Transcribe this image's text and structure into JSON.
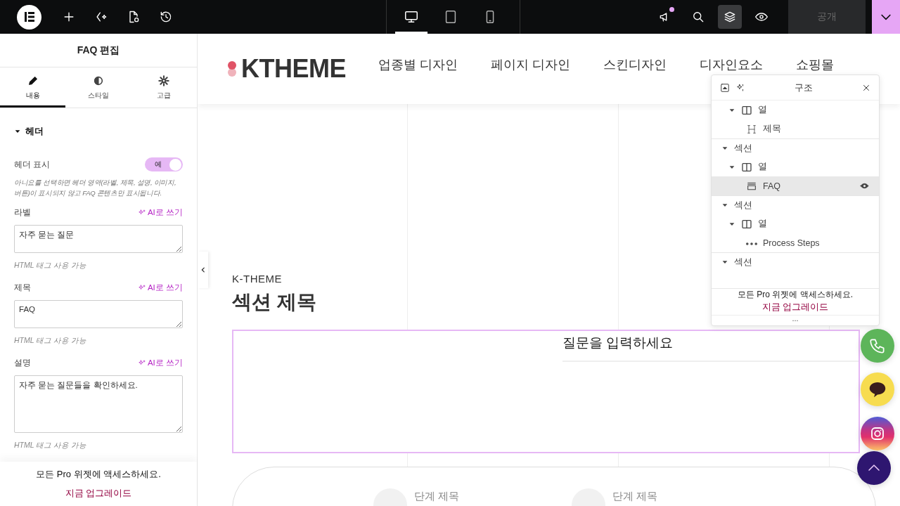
{
  "topbar": {
    "devices": [
      {
        "kind": "desktop",
        "selected": true
      },
      {
        "kind": "tablet",
        "selected": false
      },
      {
        "kind": "mobile",
        "selected": false
      }
    ],
    "notification": true,
    "layers_active": true,
    "publish": {
      "label": "공개",
      "disabled": true
    }
  },
  "editor": {
    "title": "FAQ 편집",
    "tabs": [
      {
        "label": "내용",
        "kind": "content",
        "selected": true
      },
      {
        "label": "스타일",
        "kind": "style",
        "selected": false
      },
      {
        "label": "고급",
        "kind": "advanced",
        "selected": false
      }
    ],
    "section": {
      "title": "헤더",
      "expanded": true
    },
    "toggle": {
      "label": "헤더 표시",
      "on": true,
      "text": "예",
      "help": "아니요를 선택하면 헤더 영역(라벨, 제목, 설명, 이미지, 버튼)이 표시되지 않고 FAQ 콘텐츠만 표시됩니다."
    },
    "fields": [
      {
        "label": "라벨",
        "ai": "AI로 쓰기",
        "value": "자주 묻는 질문",
        "hint": "HTML 태그 사용 가능",
        "kind": "short"
      },
      {
        "label": "제목",
        "ai": "AI로 쓰기",
        "value": "FAQ",
        "hint": "HTML 태그 사용 가능",
        "kind": "short"
      },
      {
        "label": "설명",
        "ai": "AI로 쓰기",
        "value": "자주 묻는 질문들을 확인하세요.",
        "hint": "HTML 태그 사용 가능",
        "kind": "long"
      }
    ],
    "promo": {
      "text": "모든 Pro 위젯에 액세스하세요.",
      "link": "지금 업그레이드"
    }
  },
  "site": {
    "logo": "KTHEME",
    "nav": [
      "업종별 디자인",
      "페이지 디자인",
      "스킨디자인",
      "디자인요소",
      "쇼핑몰"
    ],
    "label": "K-THEME",
    "title": "섹션 제목",
    "faq": {
      "question": "질문을 입력하세요"
    },
    "steps": [
      {
        "title": "단계 제목"
      },
      {
        "title": "단계 제목"
      }
    ]
  },
  "structure": {
    "title": "구조",
    "tree": [
      {
        "label": "열",
        "kind": "column",
        "expanded": true,
        "selected": false,
        "children": [
          {
            "label": "제목",
            "kind": "heading",
            "selected": false
          }
        ]
      },
      {
        "label": "섹션",
        "kind": "section",
        "expanded": true,
        "selected": false,
        "children": [
          {
            "label": "열",
            "kind": "column",
            "expanded": true,
            "selected": false,
            "children": [
              {
                "label": "FAQ",
                "kind": "faq",
                "selected": true
              }
            ]
          }
        ]
      },
      {
        "label": "섹션",
        "kind": "section",
        "expanded": true,
        "selected": false,
        "children": [
          {
            "label": "열",
            "kind": "column",
            "expanded": true,
            "selected": false,
            "children": [
              {
                "label": "Process Steps",
                "kind": "steps",
                "selected": false
              }
            ]
          }
        ]
      },
      {
        "label": "섹션",
        "kind": "section",
        "expanded": true,
        "selected": false
      }
    ],
    "promo": {
      "text": "모든 Pro 위젯에 액세스하세요.",
      "link": "지금 업그레이드"
    },
    "more": "..."
  },
  "floating": [
    {
      "kind": "phone"
    },
    {
      "kind": "chat"
    },
    {
      "kind": "instagram"
    },
    {
      "kind": "top"
    }
  ]
}
